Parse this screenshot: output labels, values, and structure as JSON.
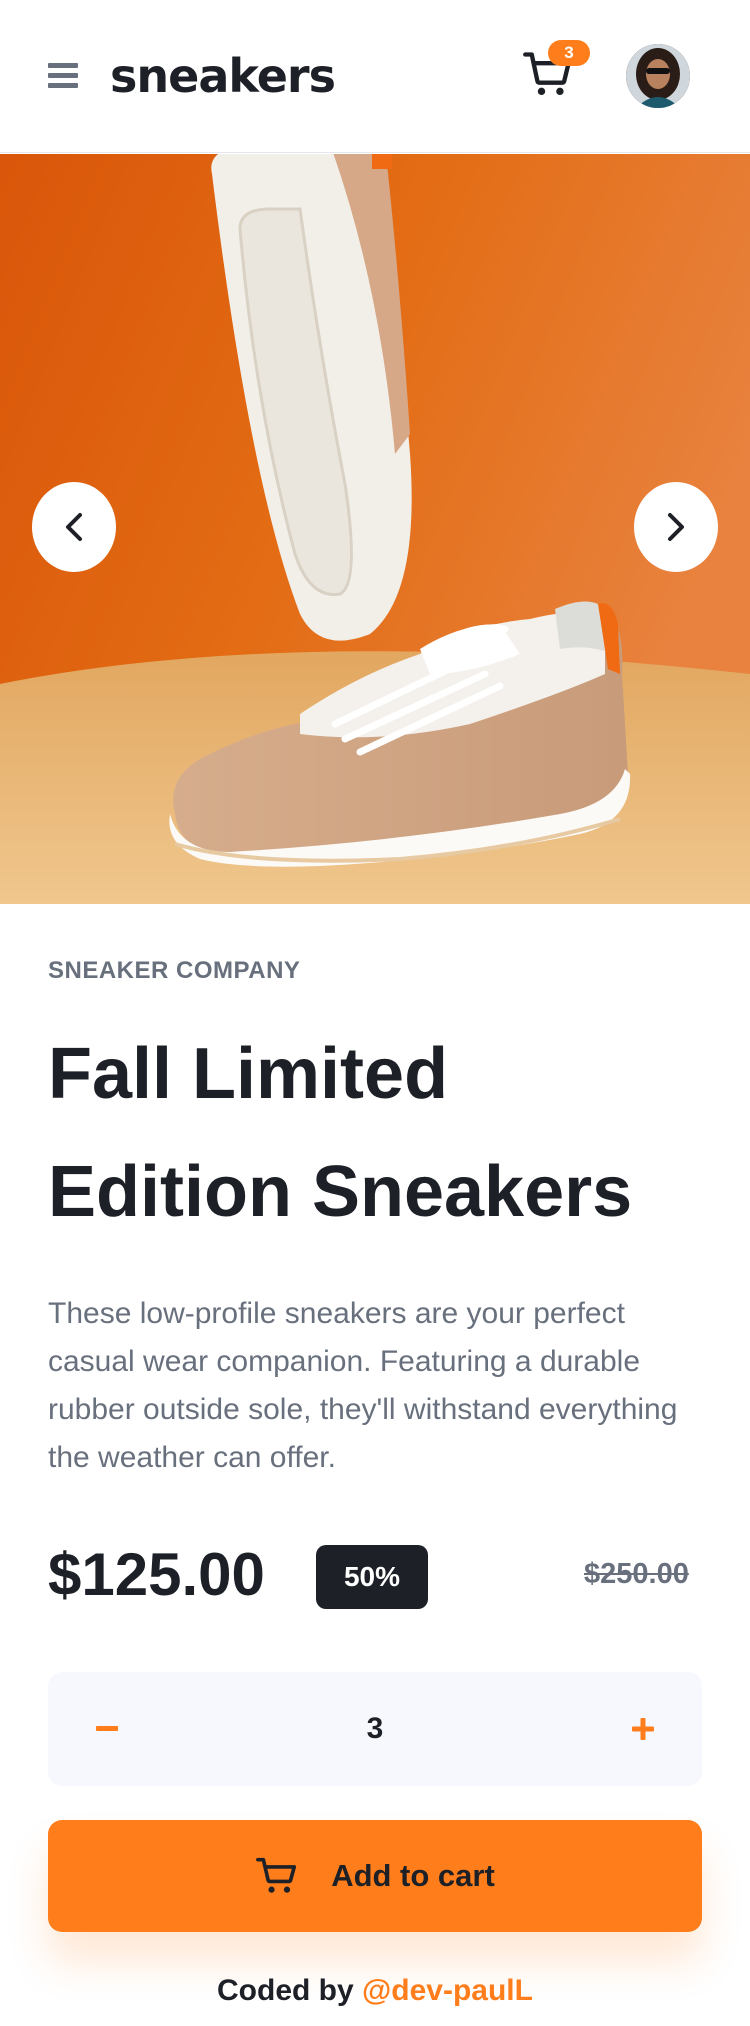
{
  "header": {
    "logo": "sneakers",
    "cart_count": "3"
  },
  "gallery": {
    "prev_icon": "chevron-left-icon",
    "next_icon": "chevron-right-icon"
  },
  "product": {
    "company": "SNEAKER COMPANY",
    "title": "Fall Limited Edition Sneakers",
    "description": "These low-profile sneakers are your perfect casual wear companion. Featuring a durable rubber outside sole, they'll withstand everything the weather can offer.",
    "price": "$125.00",
    "discount": "50%",
    "original_price": "$250.00"
  },
  "quantity": {
    "value": "3",
    "minus_icon": "minus-icon",
    "plus_icon": "plus-icon"
  },
  "actions": {
    "add_to_cart": "Add to cart"
  },
  "footer": {
    "prefix": "Coded by ",
    "author": "@dev-paulL"
  },
  "colors": {
    "accent": "#ff7e1b",
    "dark": "#1d2026",
    "muted": "#69707d",
    "pale": "#f6f8fd"
  }
}
